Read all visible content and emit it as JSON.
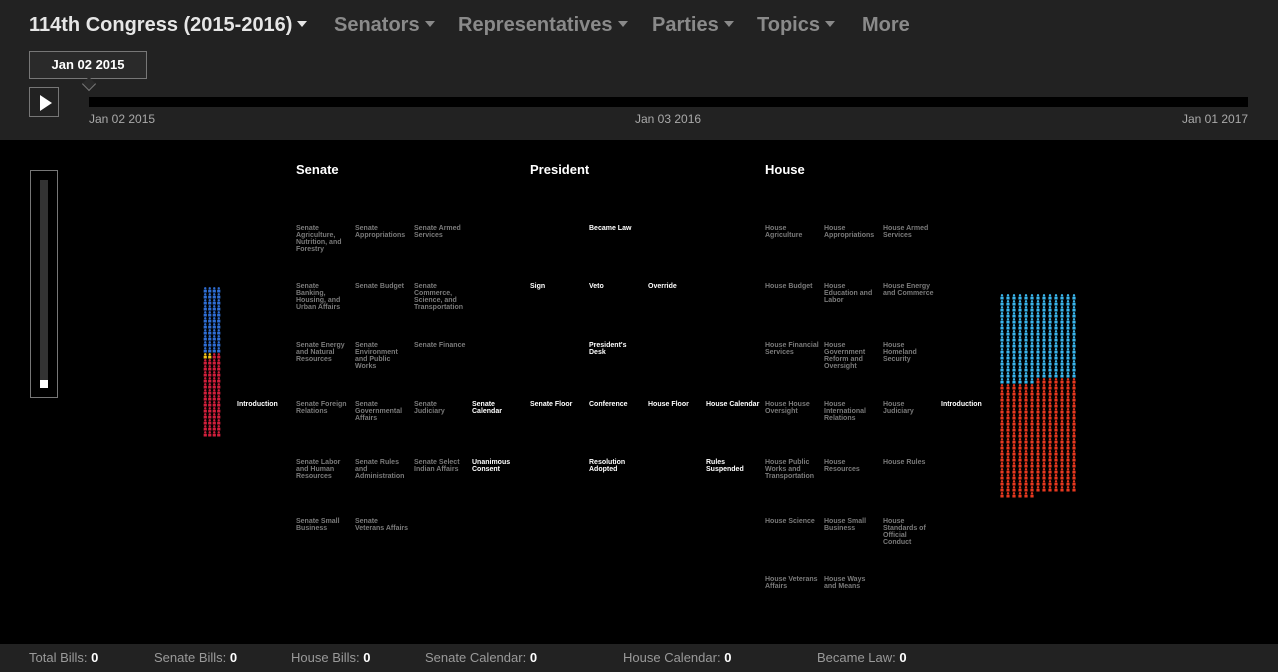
{
  "nav": {
    "congress": "114th Congress (2015-2016)",
    "senators": "Senators",
    "representatives": "Representatives",
    "parties": "Parties",
    "topics": "Topics",
    "more": "More"
  },
  "timeline": {
    "current": "Jan 02 2015",
    "start": "Jan 02 2015",
    "mid": "Jan 03 2016",
    "end": "Jan 01 2017",
    "progress": 0
  },
  "headers": {
    "senate": "Senate",
    "president": "President",
    "house": "House"
  },
  "nodes": {
    "senate_intro": "Introduction",
    "s_ag": "Senate Agriculture, Nutrition, and Forestry",
    "s_approp": "Senate Appropriations",
    "s_armed": "Senate Armed Services",
    "s_banking": "Senate Banking, Housing, and Urban Affairs",
    "s_budget": "Senate Budget",
    "s_commerce": "Senate Commerce, Science, and Transportation",
    "s_energy": "Senate Energy and Natural Resources",
    "s_env": "Senate Environment and Public Works",
    "s_finance": "Senate Finance",
    "s_foreign": "Senate Foreign Relations",
    "s_gov": "Senate Governmental Affairs",
    "s_jud": "Senate Judiciary",
    "s_calendar": "Senate Calendar",
    "s_labor": "Senate Labor and Human Resources",
    "s_rules": "Senate Rules and Administration",
    "s_indian": "Senate Select Indian Affairs",
    "s_unanimous": "Unanimous Consent",
    "s_small": "Senate Small Business",
    "s_vet": "Senate Veterans Affairs",
    "p_law": "Became Law",
    "p_sign": "Sign",
    "p_veto": "Veto",
    "p_override": "Override",
    "p_desk": "President's Desk",
    "p_senate_floor": "Senate Floor",
    "p_conference": "Conference",
    "p_house_floor": "House Floor",
    "p_house_cal": "House Calendar",
    "p_resolution": "Resolution Adopted",
    "p_rules_susp": "Rules Suspended",
    "h_ag": "House Agriculture",
    "h_approp": "House Appropriations",
    "h_armed": "House Armed Services",
    "h_budget": "House Budget",
    "h_edu": "House Education and Labor",
    "h_energy": "House Energy and Commerce",
    "h_fin": "House Financial Services",
    "h_gov": "House Government Reform and Oversight",
    "h_homeland": "House Homeland Security",
    "h_oversight": "House House Oversight",
    "h_intl": "House International Relations",
    "h_jud": "House Judiciary",
    "house_intro": "Introduction",
    "h_public": "House Public Works and Transportation",
    "h_res": "House Resources",
    "h_rules": "House Rules",
    "h_sci": "House Science",
    "h_small": "House Small Business",
    "h_stand": "House Standards of Official Conduct",
    "h_vet": "House Veterans Affairs",
    "h_ways": "House Ways and Means"
  },
  "members": {
    "colors": {
      "senate_dem": "#2f6fd6",
      "senate_ind": "#f2c21b",
      "senate_rep": "#d21f3c",
      "house_dem": "#3ab7ee",
      "house_rep": "#e8381f"
    },
    "senate": {
      "democrat": 44,
      "independent": 2,
      "republican": 54
    },
    "house": {
      "democrat": 188,
      "republican": 247
    }
  },
  "footer": {
    "total_label": "Total Bills:",
    "total": "0",
    "senate_label": "Senate Bills:",
    "senate": "0",
    "house_label": "House Bills:",
    "house": "0",
    "scal_label": "Senate Calendar:",
    "scal": "0",
    "hcal_label": "House Calendar:",
    "hcal": "0",
    "law_label": "Became Law:",
    "law": "0"
  }
}
